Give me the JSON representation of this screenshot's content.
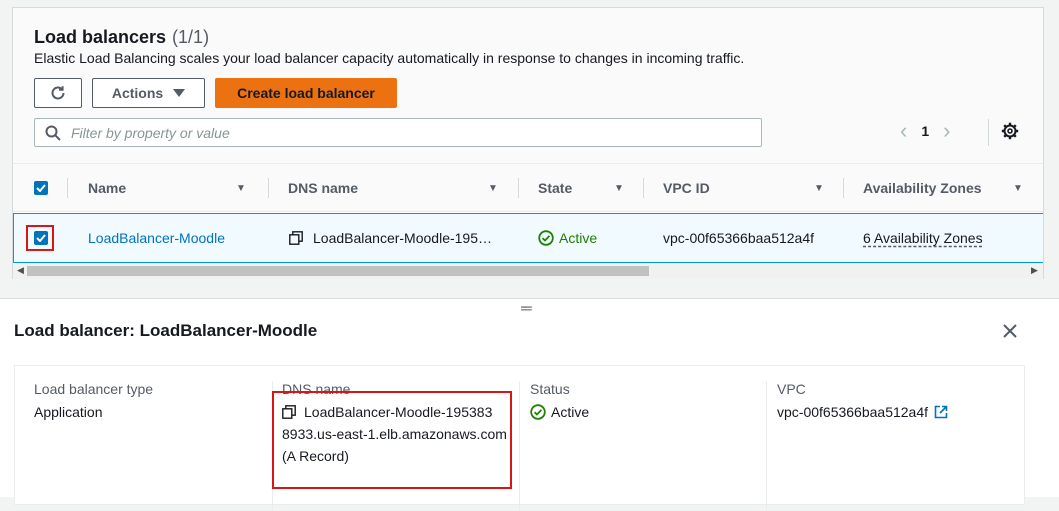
{
  "panel": {
    "title": "Load balancers",
    "count": "(1/1)",
    "subtitle": "Elastic Load Balancing scales your load balancer capacity automatically in response to changes in incoming traffic.",
    "actions_label": "Actions",
    "create_label": "Create load balancer",
    "search_placeholder": "Filter by property or value",
    "page_number": "1"
  },
  "table": {
    "columns": [
      "Name",
      "DNS name",
      "State",
      "VPC ID",
      "Availability Zones"
    ],
    "row": {
      "name": "LoadBalancer-Moodle",
      "dns": "LoadBalancer-Moodle-195…",
      "state": "Active",
      "vpc": "vpc-00f65366baa512a4f",
      "azs": "6 Availability Zones"
    }
  },
  "details": {
    "title": "Load balancer: LoadBalancer-Moodle",
    "type_label": "Load balancer type",
    "type_value": "Application",
    "dns_label": "DNS name",
    "dns_line1": "LoadBalancer-Moodle-195383",
    "dns_line2": "8933.us-east-1.elb.amazonaws.com",
    "dns_line3": "(A Record)",
    "status_label": "Status",
    "status_value": "Active",
    "vpc_label": "VPC",
    "vpc_value": "vpc-00f65366baa512a4f"
  },
  "colors": {
    "accent": "#ec7211",
    "link": "#0073bb",
    "success": "#1d8102",
    "highlight": "#d91515"
  }
}
